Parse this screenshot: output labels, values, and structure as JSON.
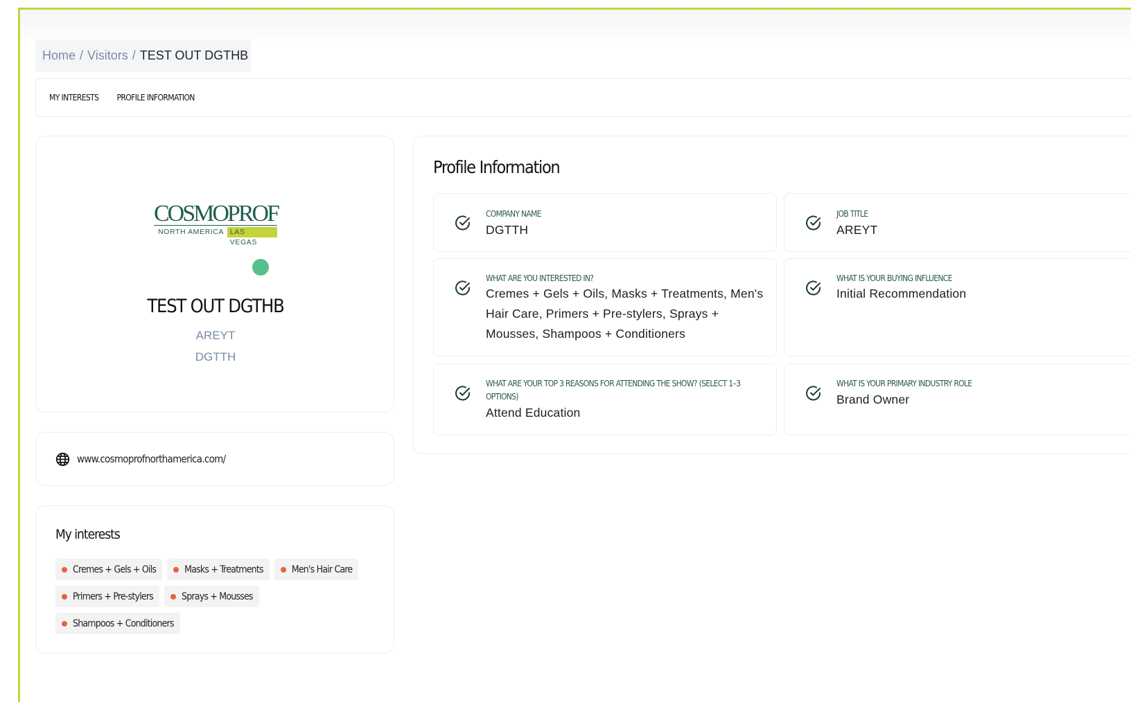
{
  "breadcrumb": {
    "home": "Home",
    "visitors": "Visitors",
    "current": "TEST OUT DGTHB"
  },
  "tabs": [
    {
      "label": "MY INTERESTS"
    },
    {
      "label": "PROFILE INFORMATION"
    }
  ],
  "profile": {
    "logo_wordmark": "COSMOPROF",
    "logo_sub_left": "NORTH AMERICA",
    "logo_sub_right": "LAS VEGAS",
    "name": "TEST OUT DGTHB",
    "job_title": "AREYT",
    "company": "DGTTH",
    "status_color": "#56c08a"
  },
  "website": {
    "icon": "globe-icon",
    "url": "www.cosmoprofnorthamerica.com/"
  },
  "interests": {
    "title": "My interests",
    "items": [
      "Cremes + Gels + Oils",
      "Masks + Treatments",
      "Men's Hair Care",
      "Primers + Pre-stylers",
      "Sprays + Mousses",
      "Shampoos + Conditioners"
    ]
  },
  "info": {
    "title": "Profile Information",
    "items": [
      {
        "label": "COMPANY NAME",
        "value": "DGTTH"
      },
      {
        "label": "JOB TITLE",
        "value": "AREYT"
      },
      {
        "label": "WHAT ARE YOU INTERESTED IN?",
        "value": "Cremes + Gels + Oils, Masks + Treatments, Men's Hair Care, Primers + Pre-stylers, Sprays + Mousses, Shampoos + Conditioners"
      },
      {
        "label": "WHAT IS YOUR BUYING INFLUENCE",
        "value": "Initial Recommendation"
      },
      {
        "label": "WHAT ARE YOUR TOP 3 REASONS FOR ATTENDING THE SHOW? (SELECT 1–3 OPTIONS)",
        "value": "Attend Education"
      },
      {
        "label": "WHAT IS YOUR PRIMARY INDUSTRY ROLE",
        "value": "Brand Owner"
      }
    ]
  },
  "colors": {
    "accent_border": "#c3d43a",
    "chip_dot": "#e8623e",
    "label_green": "#2d5a4e"
  }
}
